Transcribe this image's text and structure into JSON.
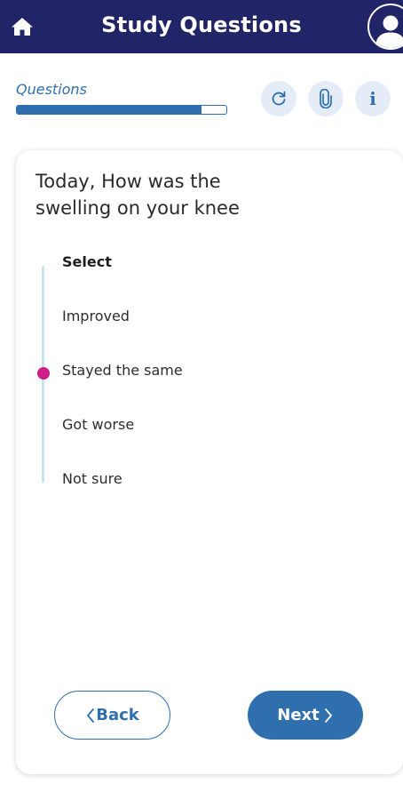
{
  "header": {
    "title": "Study Questions",
    "home_icon": "home-icon",
    "profile_icon": "user-avatar-icon",
    "background": "#212467"
  },
  "progress": {
    "label": "Questions",
    "fraction": 0.88,
    "color": "#2f6fad"
  },
  "tools": [
    {
      "icon": "refresh-icon"
    },
    {
      "icon": "paperclip-icon"
    },
    {
      "icon": "info-icon",
      "glyph": "i"
    }
  ],
  "question": {
    "text": "Today, How was the swelling on your knee",
    "select_label": "Select",
    "options": [
      "Improved",
      "Stayed the same",
      "Got worse",
      "Not sure"
    ],
    "selected_index": 1,
    "selected_color": "#cc1f8a"
  },
  "nav": {
    "back_label": "Back",
    "next_label": "Next"
  }
}
